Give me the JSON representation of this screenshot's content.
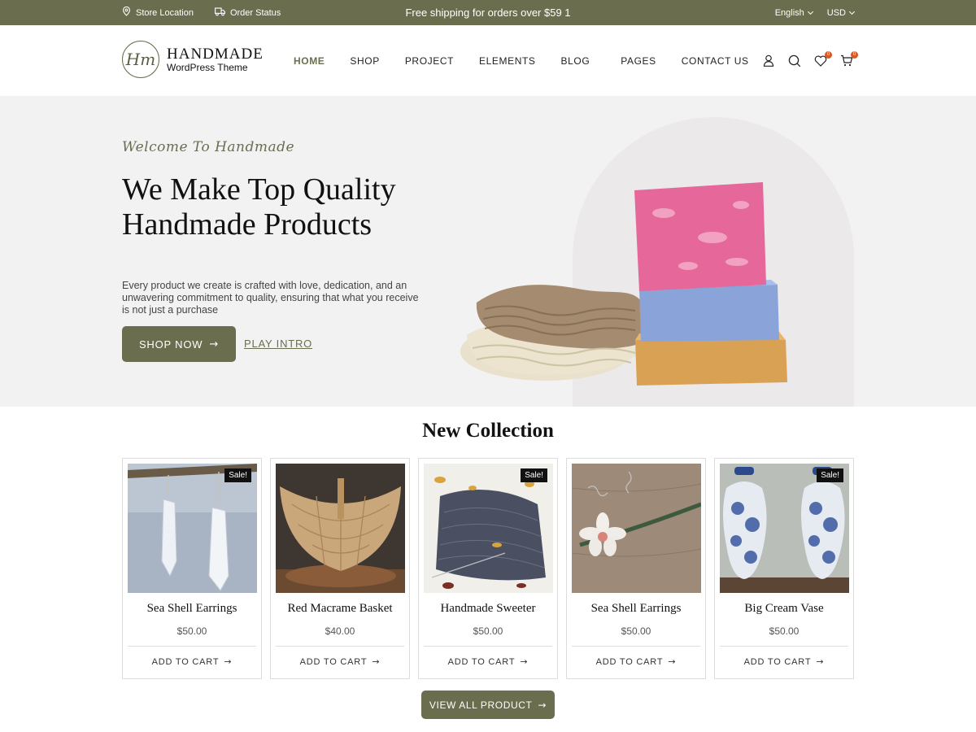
{
  "topbar": {
    "store_location": "Store Location",
    "order_status": "Order Status",
    "promo": "Free shipping for orders over $59 1",
    "language": "English",
    "currency": "USD"
  },
  "header": {
    "logo_mark": "Hm",
    "logo_title": "HANDMADE",
    "logo_subtitle": "WordPress Theme",
    "nav": [
      "HOME",
      "SHOP",
      "PROJECT",
      "ELEMENTS",
      "BLOG",
      "PAGES",
      "CONTACT US"
    ],
    "wishlist_count": "0",
    "cart_count": "0"
  },
  "hero": {
    "script": "Welcome To Handmade",
    "title": "We Make Top Quality Handmade Products",
    "description": "Every product we create is crafted with love, dedication, and an unwavering commitment to quality, ensuring that what you receive is not just a purchase",
    "shop_button": "SHOP NOW",
    "intro_link": "PLAY INTRO"
  },
  "collection": {
    "title": "New Collection",
    "sale_label": "Sale!",
    "add_to_cart": "ADD TO CART",
    "products": [
      {
        "name": "Sea Shell Earrings",
        "price": "$50.00",
        "sale": true
      },
      {
        "name": "Red Macrame Basket",
        "price": "$40.00",
        "sale": false
      },
      {
        "name": "Handmade Sweeter",
        "price": "$50.00",
        "sale": true
      },
      {
        "name": "Sea Shell Earrings",
        "price": "$50.00",
        "sale": false
      },
      {
        "name": "Big Cream Vase",
        "price": "$50.00",
        "sale": true
      }
    ],
    "view_all": "VIEW ALL PRODUCT"
  },
  "colors": {
    "brand": "#6a6e4e",
    "badge": "#d9582a"
  }
}
